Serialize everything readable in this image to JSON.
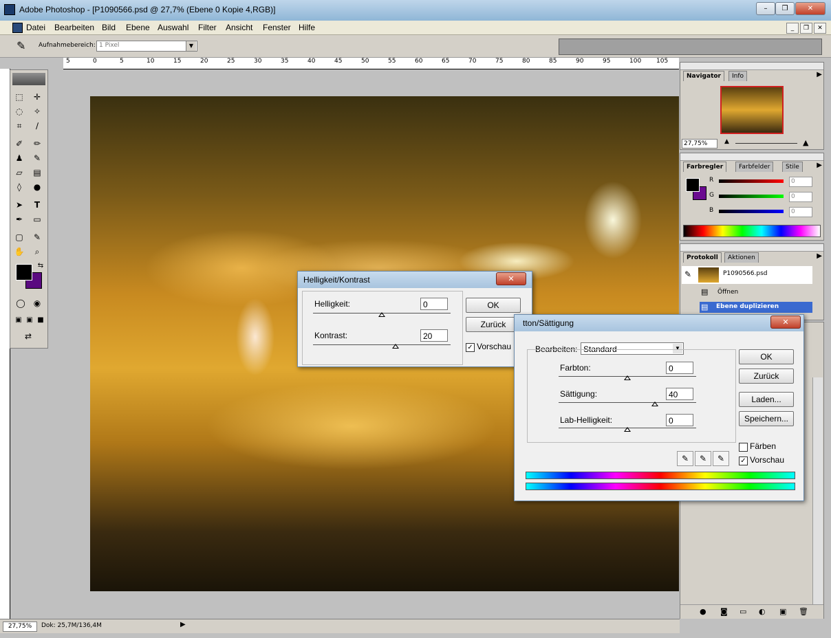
{
  "window": {
    "title": "Adobe Photoshop - [P1090566.psd @ 27,7% (Ebene 0 Kopie 4,RGB)]"
  },
  "menu": [
    "Datei",
    "Bearbeiten",
    "Bild",
    "Ebene",
    "Auswahl",
    "Filter",
    "Ansicht",
    "Fenster",
    "Hilfe"
  ],
  "options": {
    "sample_label": "Aufnahmebereich:",
    "sample_value": "1 Pixel"
  },
  "ruler": {
    "h_ticks": [
      "5",
      "0",
      "5",
      "10",
      "15",
      "20",
      "25",
      "30",
      "35",
      "40",
      "45",
      "50",
      "55",
      "60",
      "65",
      "70",
      "75",
      "80",
      "85",
      "90",
      "95",
      "100",
      "105"
    ]
  },
  "status": {
    "zoom": "27,75%",
    "doc": "Dok: 25,7M/136,4M"
  },
  "navigator": {
    "tabs": [
      "Navigator",
      "Info"
    ],
    "zoom": "27,75%"
  },
  "color_palette": {
    "tabs": [
      "Farbregler",
      "Farbfelder",
      "Stile"
    ],
    "channels": [
      {
        "label": "R",
        "value": "0"
      },
      {
        "label": "G",
        "value": "0"
      },
      {
        "label": "B",
        "value": "0"
      }
    ]
  },
  "history": {
    "tabs": [
      "Protokoll",
      "Aktionen"
    ],
    "snapshot": "P1090566.psd",
    "items": [
      "Öffnen",
      "Ebene duplizieren"
    ]
  },
  "brightness_dialog": {
    "title": "Helligkeit/Kontrast",
    "brightness_label": "Helligkeit:",
    "brightness_value": "0",
    "contrast_label": "Kontrast:",
    "contrast_value": "20",
    "ok": "OK",
    "reset": "Zurück",
    "preview": "Vorschau"
  },
  "hue_dialog": {
    "title": "tton/Sättigung",
    "edit_label": "Bearbeiten:",
    "edit_value": "Standard",
    "hue_label": "Farbton:",
    "hue_value": "0",
    "sat_label": "Sättigung:",
    "sat_value": "40",
    "light_label": "Lab-Helligkeit:",
    "light_value": "0",
    "ok": "OK",
    "reset": "Zurück",
    "load": "Laden...",
    "save": "Speichern...",
    "colorize": "Färben",
    "preview": "Vorschau"
  }
}
